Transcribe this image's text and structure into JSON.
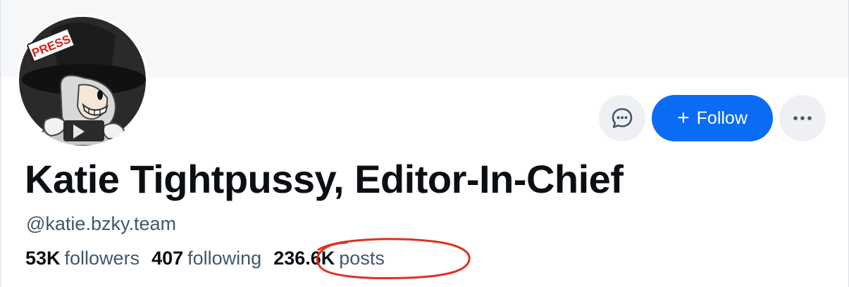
{
  "profile": {
    "display_name": "Katie Tightpussy, Editor-In-Chief",
    "handle": "@katie.bzky.team",
    "avatar_badge": "PRESS"
  },
  "actions": {
    "follow_label": "Follow",
    "follow_icon": "plus-icon",
    "message_icon": "chat-bubble-icon",
    "more_icon": "ellipsis-icon"
  },
  "stats": {
    "followers_count": "53K",
    "followers_label": "followers",
    "following_count": "407",
    "following_label": "following",
    "posts_count": "236.6K",
    "posts_label": "posts"
  },
  "colors": {
    "accent": "#0a6cf5",
    "annotation": "#e0301e",
    "banner": "#f5f7f9",
    "secondary_text": "#42576c"
  }
}
